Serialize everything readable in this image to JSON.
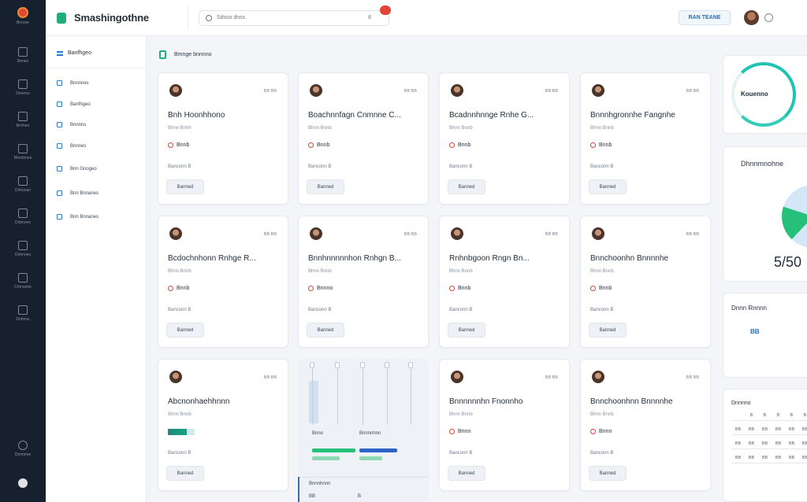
{
  "app": {
    "title": "Smashingothne"
  },
  "rail": {
    "top_label": "Bnnore",
    "items": [
      "Bnnes",
      "Dnnnno",
      "Brrrhes",
      "Bhnnhnes",
      "Dnhsnan",
      "Dnhnons",
      "Dnhnnes",
      "Crhrssme",
      "Dnhnns"
    ],
    "bottom_label": "Dnnmme"
  },
  "topbar": {
    "search_placeholder": "Sdsso dnss",
    "search_right": "8",
    "primary_button": "RAN TEANE"
  },
  "sidebar": {
    "header": "Banfhgeo",
    "items": [
      "Bnnnnes",
      "Banfhgeo",
      "Bnnnns",
      "Bnnnes",
      "Bnn Gnogeo",
      "Bnn Bnnanes",
      "Bnn Bnnanes"
    ]
  },
  "main": {
    "header": "Bmnge bnnnno"
  },
  "cards": [
    {
      "status": "BB BB",
      "title": "Bnh Hoonhhono",
      "subtitle": "Bhnn Bnhh",
      "tag": "Bnnb",
      "meta": "Banconn B",
      "button": "Banned"
    },
    {
      "status": "BB BB",
      "title": "Boachnnfagn Cnmnne C...",
      "subtitle": "Bhnn Bnnb",
      "tag": "Bnnb",
      "meta": "Banconn B",
      "button": "Banned"
    },
    {
      "status": "BB BB",
      "title": "Bcadnnhnnge Rnhe G...",
      "subtitle": "Bhnn Bnnb",
      "tag": "Bnnb",
      "meta": "Banconn B",
      "button": "Banned"
    },
    {
      "status": "BB BB",
      "title": "Bnnnhgronnhe Fangnhe",
      "subtitle": "Bhnn Bnnb",
      "tag": "Bnnb",
      "meta": "Banconn B",
      "button": "Banned"
    },
    {
      "status": "BB BB",
      "title": "Bcdochnhonn Rnhge R...",
      "subtitle": "Bhnn Bnnb",
      "tag": "Bnnb",
      "meta": "Banconn B",
      "button": "Banned"
    },
    {
      "status": "BB BB",
      "title": "Bnnhnnnnnhon Rnhgn B...",
      "subtitle": "Bhnn Bnnb",
      "tag": "Bnnno",
      "meta": "Banconn B",
      "button": "Banned"
    },
    {
      "status": "BB BB",
      "title": "Rnhnbgoon Rngn Bn...",
      "subtitle": "Bhnn Bnnb",
      "tag": "Bnnb",
      "meta": "Banconn B",
      "button": "Banned"
    },
    {
      "status": "BB BB",
      "title": "Bnnchoonhn Bnnnnhe",
      "subtitle": "Bhnn Bnnb",
      "tag": "Bnnb",
      "meta": "Banconn B",
      "button": "Banned"
    },
    {
      "status": "BB BB",
      "title": "Abcnonhaehhnnn",
      "subtitle": "Bhnn Bnnb",
      "tag": "",
      "meta": "Banconn B",
      "button": "Banned"
    },
    {
      "status": "BB BB",
      "title": "Bnnnnnnhn Fnonnho",
      "subtitle": "Bhnn Bnnb",
      "tag": "Bnnn",
      "meta": "Banconn B",
      "button": "Banned"
    },
    {
      "status": "BB BB",
      "title": "Bnnchoonhnn Bnnnnhe",
      "subtitle": "Bhnn Bnnb",
      "tag": "Bnnn",
      "meta": "Banconn B",
      "button": "Banned"
    }
  ],
  "chart_panel": {
    "legend_left": "Bnno",
    "legend_right": "Bnnnnhnn",
    "footer_label": "Bnnnhnnn",
    "footer_values": [
      "BB",
      "B"
    ],
    "progress": [
      0.95,
      0.82,
      0.6,
      0.5
    ]
  },
  "right": {
    "ring_label": "Kouenno",
    "pie_title": "Dhnnmnohne",
    "pie_value": "5/50",
    "stat_label": "Dnnn Rnnnn",
    "stat_value": "BB",
    "calendar_title": "Dnnnno",
    "calendar_cells": [
      "",
      "B",
      "B",
      "B",
      "B",
      "B",
      "BB",
      "BB",
      "BB",
      "BB",
      "BB",
      "BB",
      "BB",
      "BB",
      "BB",
      "BB",
      "BB",
      "BB",
      "BB",
      "BB",
      "BB",
      "BB",
      "BB",
      "BB"
    ]
  },
  "colors": {
    "accent_green": "#1fae7a",
    "accent_blue": "#2b7bd3",
    "rail_bg": "#17202e",
    "alert_red": "#e2443a"
  }
}
